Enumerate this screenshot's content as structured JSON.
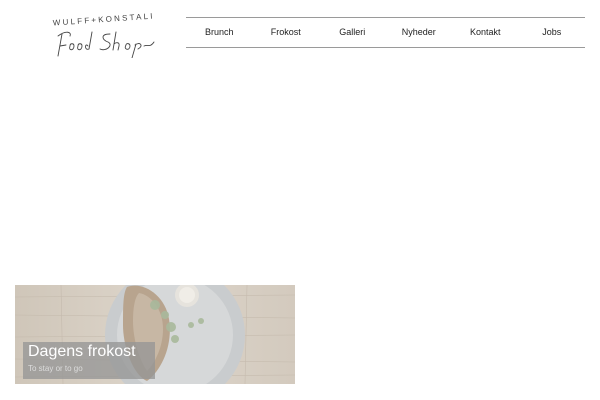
{
  "logo": {
    "top_text": "WULFF+KONSTALI",
    "script_text": "Food Shop"
  },
  "nav": {
    "items": [
      {
        "label": "Brunch"
      },
      {
        "label": "Frokost"
      },
      {
        "label": "Galleri"
      },
      {
        "label": "Nyheder"
      },
      {
        "label": "Kontakt"
      },
      {
        "label": "Jobs"
      }
    ]
  },
  "card": {
    "title": "Dagens frokost",
    "subtitle": "To stay or to go"
  },
  "colors": {
    "nav_border": "#9a9a9a",
    "caption_bg": "#969696",
    "text": "#222222"
  }
}
